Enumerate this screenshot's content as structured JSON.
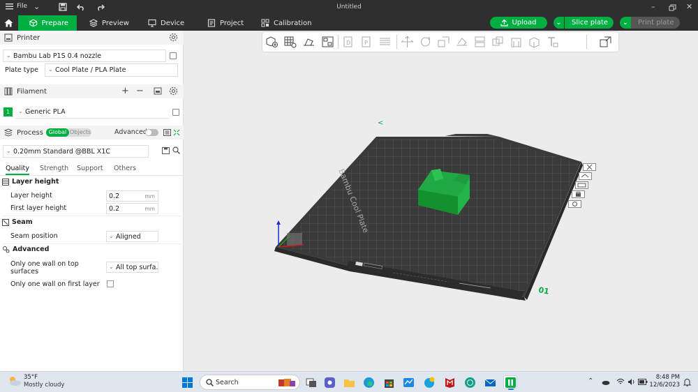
{
  "titlebar": {
    "file_label": "File",
    "title": "Untitled"
  },
  "nav": {
    "tabs": [
      {
        "label": "Prepare"
      },
      {
        "label": "Preview"
      },
      {
        "label": "Device"
      },
      {
        "label": "Project"
      },
      {
        "label": "Calibration"
      }
    ],
    "upload": "Upload",
    "slice": "Slice plate",
    "print": "Print plate"
  },
  "printer": {
    "header": "Printer",
    "name": "Bambu Lab P1S 0.4 nozzle",
    "plate_type_label": "Plate type",
    "plate_type_value": "Cool Plate / PLA Plate"
  },
  "filament": {
    "header": "Filament",
    "index": "1",
    "name": "Generic PLA"
  },
  "process": {
    "header": "Process",
    "toggle_global": "Global",
    "toggle_objects": "Objects",
    "advanced_label": "Advanced",
    "profile": "0.20mm Standard @BBL X1C",
    "tabs": [
      "Quality",
      "Strength",
      "Support",
      "Others"
    ]
  },
  "settings": {
    "layer_height_group": "Layer height",
    "layer_height_label": "Layer height",
    "layer_height_value": "0.2",
    "first_layer_label": "First layer height",
    "first_layer_value": "0.2",
    "unit": "mm",
    "seam_group": "Seam",
    "seam_position_label": "Seam position",
    "seam_position_value": "Aligned",
    "advanced_group": "Advanced",
    "one_wall_top_label_1": "Only one wall on top",
    "one_wall_top_label_2": "surfaces",
    "one_wall_top_value": "All top surfa...",
    "one_wall_first_label": "Only one wall on first layer"
  },
  "plate": {
    "brand": "Bambu Cool Plate",
    "number": "01"
  },
  "taskbar": {
    "weather_temp": "35°F",
    "weather_desc": "Mostly cloudy",
    "search_placeholder": "Search",
    "time": "8:48 PM",
    "date": "12/6/2023"
  },
  "colors": {
    "accent": "#00ae42",
    "dark_bar": "#2f2f2f",
    "object": "#1fa844"
  }
}
